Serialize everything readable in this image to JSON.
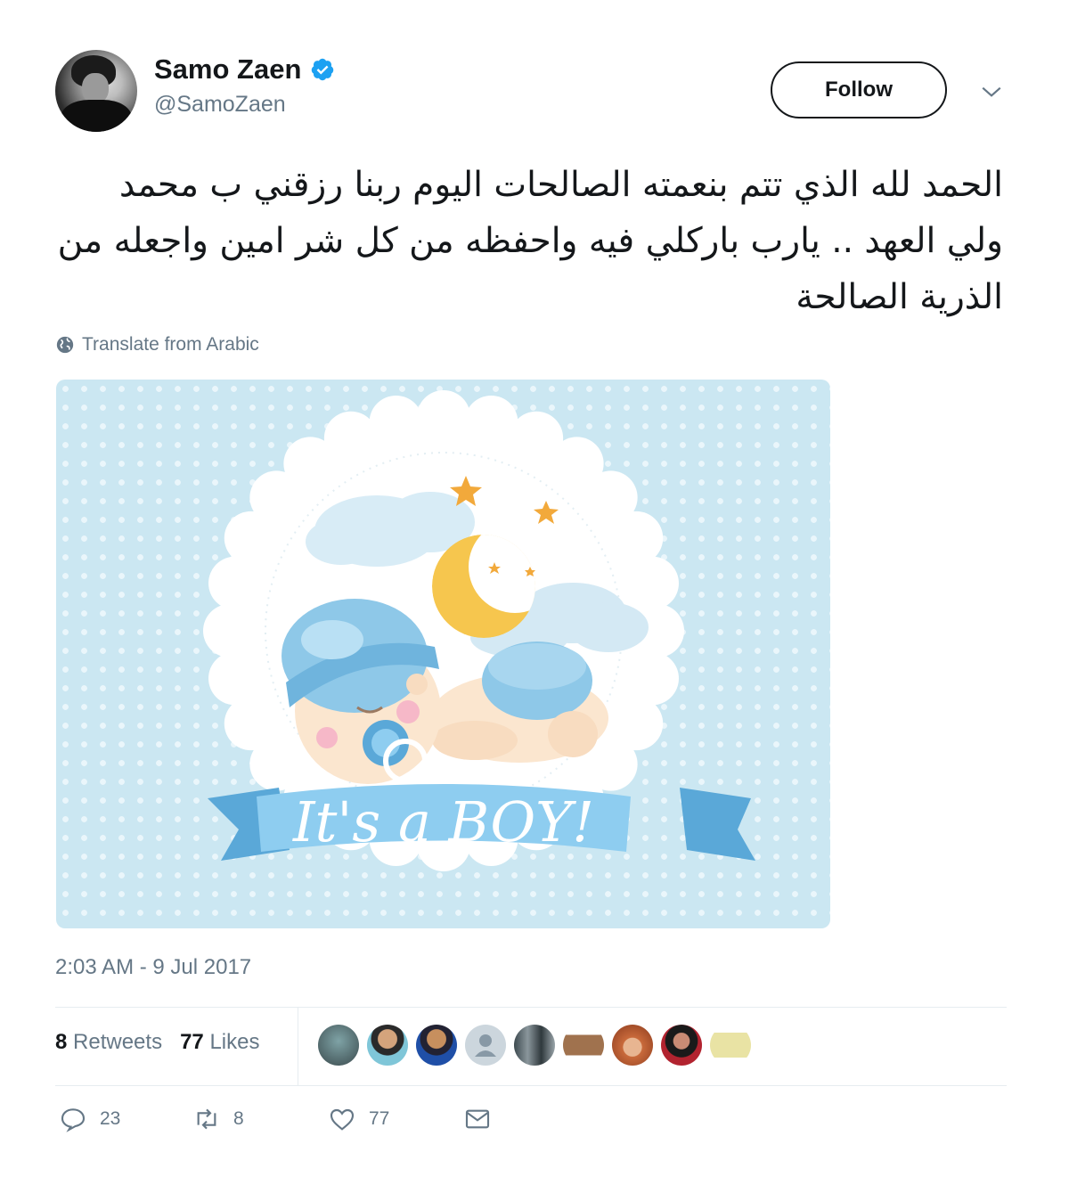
{
  "author": {
    "name": "Samo Zaen",
    "handle": "@SamoZaen",
    "verified": true
  },
  "follow_label": "Follow",
  "tweet": {
    "text": "الحمد لله الذي تتم بنعمته الصالحات اليوم ربنا رزقني ب محمد ولي العهد .. يارب باركلي فيه واحفظه من كل شر امين واجعله من الذرية الصالحة",
    "translate_label": "Translate from Arabic",
    "timestamp": "2:03 AM - 9 Jul 2017"
  },
  "media": {
    "banner_text": "It's a BOY!"
  },
  "stats": {
    "retweets_count": "8",
    "retweets_label": "Retweets",
    "likes_count": "77",
    "likes_label": "Likes"
  },
  "actions": {
    "reply_count": "23",
    "retweet_count": "8",
    "like_count": "77"
  },
  "colors": {
    "text": "#14171a",
    "secondary": "#657786",
    "verified": "#1da1f2",
    "divider": "#e6ecf0",
    "image_bg": "#cbe7f2"
  }
}
